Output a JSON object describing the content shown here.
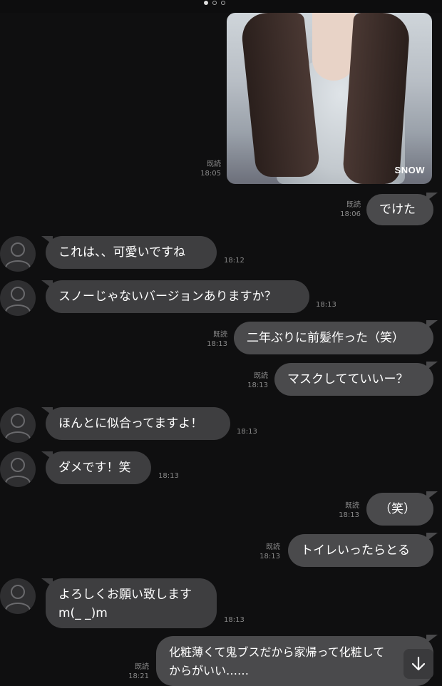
{
  "pager": {
    "pages": 3,
    "active": 0
  },
  "photo": {
    "watermark": "SNOW"
  },
  "read_label": "既読",
  "messages": [
    {
      "id": "m1",
      "side": "out",
      "read": true,
      "time": "18:05",
      "type": "image"
    },
    {
      "id": "m2",
      "side": "out",
      "read": true,
      "time": "18:06",
      "text": "でけた"
    },
    {
      "id": "m3",
      "side": "in",
      "time": "18:12",
      "text": "これは、、可愛いですね"
    },
    {
      "id": "m4",
      "side": "in",
      "time": "18:13",
      "text": "スノーじゃないバージョンありますか？"
    },
    {
      "id": "m5",
      "side": "out",
      "read": true,
      "time": "18:13",
      "text": "二年ぶりに前髪作った（笑）"
    },
    {
      "id": "m6",
      "side": "out",
      "read": true,
      "time": "18:13",
      "text": "マスクしてていいー？"
    },
    {
      "id": "m7",
      "side": "in",
      "time": "18:13",
      "text": "ほんとに似合ってますよ！"
    },
    {
      "id": "m8",
      "side": "in",
      "time": "18:13",
      "text": "ダメです！笑"
    },
    {
      "id": "m9",
      "side": "out",
      "read": true,
      "time": "18:13",
      "text": "（笑）"
    },
    {
      "id": "m10",
      "side": "out",
      "read": true,
      "time": "18:13",
      "text": "トイレいったらとる"
    },
    {
      "id": "m11",
      "side": "in",
      "time": "18:13",
      "text": "よろしくお願い致します\nm(_ _)m"
    },
    {
      "id": "m12",
      "side": "out",
      "read": true,
      "time": "18:21",
      "text": "化粧薄くて鬼ブスだから家帰って化粧して\nからがいい……"
    }
  ],
  "icons": {
    "scroll_down": "arrow-down-icon",
    "avatar": "default-avatar-icon"
  }
}
